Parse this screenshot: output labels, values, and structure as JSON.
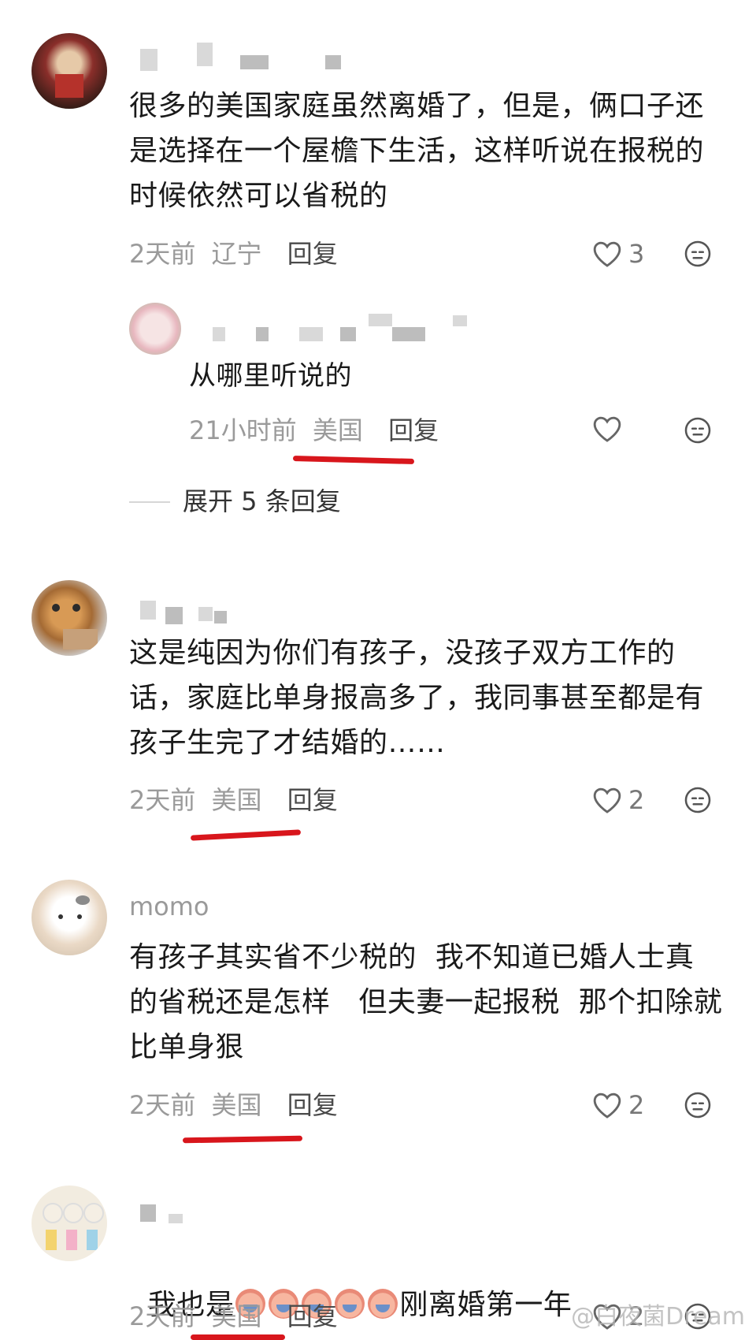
{
  "comments": [
    {
      "text": "很多的美国家庭虽然离婚了，但是，俩口子还\n是选择在一个屋檐下生活，这样听说在报税的\n时候依然可以省税的",
      "time": "2天前",
      "location": "辽宁",
      "reply_label": "回复",
      "likes": "3"
    },
    {
      "text": "这是纯因为你们有孩子，没孩子双方工作的\n话，家庭比单身报高多了，我同事甚至都是有\n孩子生完了才结婚的……",
      "time": "2天前",
      "location": "美国",
      "reply_label": "回复",
      "likes": "2"
    },
    {
      "username": "momo",
      "text": "有孩子其实省不少税的  我不知道已婚人士真\n的省税还是怎样   但夫妻一起报税  那个扣除就\n比单身狠",
      "time": "2天前",
      "location": "美国",
      "reply_label": "回复",
      "likes": "2"
    },
    {
      "text_before": "我也是",
      "text_after": "刚离婚第一年",
      "time": "2天前",
      "location": "美国",
      "reply_label": "回复",
      "likes": "2"
    }
  ],
  "reply": {
    "text": "从哪里听说的",
    "time": "21小时前",
    "location": "美国",
    "reply_label": "回复"
  },
  "expand_replies": "展开 5 条回复",
  "watermark": "@白夜菌Dream",
  "colors": {
    "underline": "#d8161c",
    "meta": "#9a9a9a"
  },
  "icons": [
    "heart-icon",
    "more-icon"
  ]
}
